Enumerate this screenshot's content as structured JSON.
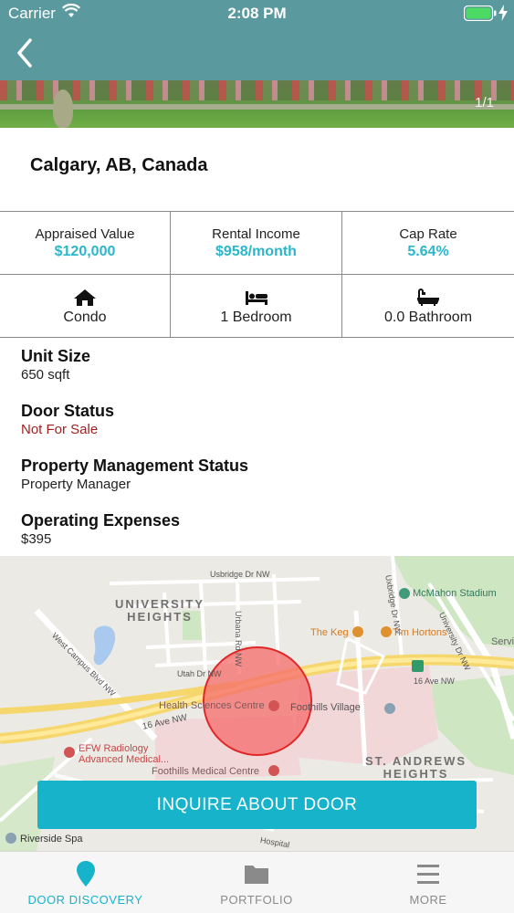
{
  "status_bar": {
    "carrier": "Carrier",
    "time": "2:08 PM"
  },
  "header": {
    "back_icon": "chevron-left-icon",
    "color": "#5a9a9f"
  },
  "photo": {
    "counter": "1/1"
  },
  "location": "Calgary, AB, Canada",
  "stats": [
    {
      "label": "Appraised Value",
      "value": "$120,000"
    },
    {
      "label": "Rental Income",
      "value": "$958/month"
    },
    {
      "label": "Cap Rate",
      "value": "5.64%"
    }
  ],
  "features": [
    {
      "icon": "house-icon",
      "label": "Condo"
    },
    {
      "icon": "bed-icon",
      "label": "1 Bedroom"
    },
    {
      "icon": "bathtub-icon",
      "label": "0.0 Bathroom"
    }
  ],
  "details": [
    {
      "title": "Unit Size",
      "value": "650 sqft"
    },
    {
      "title": "Door Status",
      "value": "Not For Sale"
    },
    {
      "title": "Property Management Status",
      "value": "Property Manager"
    },
    {
      "title": "Operating Expenses",
      "value": "$395"
    }
  ],
  "map": {
    "labels": {
      "university_heights": "UNIVERSITY\nHEIGHTS",
      "st_andrews_heights": "ST. ANDREWS\nHEIGHTS",
      "mcmahon": "McMahon Stadium",
      "the_keg": "The Keg",
      "tim_hortons": "Tim Hortons",
      "health_sciences": "Health Sciences Centre",
      "foothills_village": "Foothills Village",
      "efw": "EFW Radiology\nAdvanced Medical...",
      "foothills_medical": "Foothills Medical Centre",
      "riverside_spa": "Riverside Spa",
      "usbridge": "Usbridge Dr NW",
      "urbana": "Urbana Rd NW",
      "utah": "Utah Dr NW",
      "west_campus": "West Campus Blvd NW",
      "ave16": "16 Ave NW",
      "ave16_right": "16 Ave NW",
      "university_dr": "University Dr NW",
      "servi": "Servi",
      "uxbridge_right": "Uxbridge Dr NW",
      "hospital": "Hospital"
    }
  },
  "inquire_button": "INQUIRE ABOUT DOOR",
  "tabs": [
    {
      "label": "DOOR DISCOVERY",
      "icon": "map-pin-icon",
      "active": true
    },
    {
      "label": "PORTFOLIO",
      "icon": "folder-icon",
      "active": false
    },
    {
      "label": "MORE",
      "icon": "menu-icon",
      "active": false
    }
  ],
  "colors": {
    "accent": "#17b3cb",
    "stat_value": "#2bb6c9",
    "not_for_sale": "#a32020"
  }
}
